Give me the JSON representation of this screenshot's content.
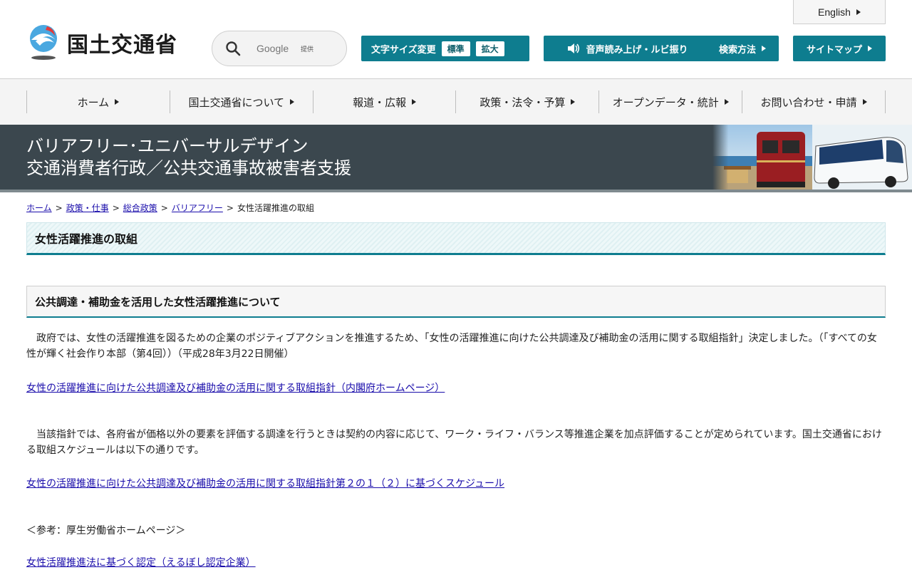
{
  "header": {
    "logo_text": "国土交通省",
    "search": {
      "placeholder": "Google",
      "provider": "提供"
    },
    "english_label": "English",
    "font_size": {
      "label": "文字サイズ変更",
      "standard": "標準",
      "large": "拡大"
    },
    "voice_label": "音声読み上げ・ルビ振り",
    "search_method_label": "検索方法",
    "sitemap_label": "サイトマップ"
  },
  "nav": {
    "items": [
      {
        "label": "ホーム"
      },
      {
        "label": "国土交通省について"
      },
      {
        "label": "報道・広報"
      },
      {
        "label": "政策・法令・予算"
      },
      {
        "label": "オープンデータ・統計"
      },
      {
        "label": "お問い合わせ・申請"
      }
    ]
  },
  "banner": {
    "line1": "バリアフリー･ユニバーサルデザイン",
    "line2": "交通消費者行政／公共交通事故被害者支援"
  },
  "breadcrumb": {
    "items": [
      {
        "label": "ホーム"
      },
      {
        "label": "政策・仕事"
      },
      {
        "label": "総合政策"
      },
      {
        "label": "バリアフリー"
      }
    ],
    "separator": ">",
    "current": "女性活躍推進の取組"
  },
  "main": {
    "title": "女性活躍推進の取組",
    "section_title": "公共調達・補助金を活用した女性活躍推進について",
    "para1": "　政府では、女性の活躍推進を図るための企業のポジティブアクションを推進するため、「女性の活躍推進に向けた公共調達及び補助金の活用に関する取組指針」決定しました。（「すべての女性が輝く社会作り本部（第4回））（平成28年3月22日開催）",
    "link1": "女性の活躍推進に向けた公共調達及び補助金の活用に関する取組指針（内閣府ホームページ）",
    "para2": "　当該指針では、各府省が価格以外の要素を評価する調達を行うときは契約の内容に応じて、ワーク・ライフ・バランス等推進企業を加点評価することが定められています。国土交通省における取組スケジュールは以下の通りです。",
    "link2": "女性の活躍推進に向けた公共調達及び補助金の活用に関する取組指針第２の１（２）に基づくスケジュール",
    "reference_label": "＜参考：厚生労働省ホームページ＞",
    "link3": "女性活躍推進法に基づく認定（えるぼし認定企業）"
  }
}
